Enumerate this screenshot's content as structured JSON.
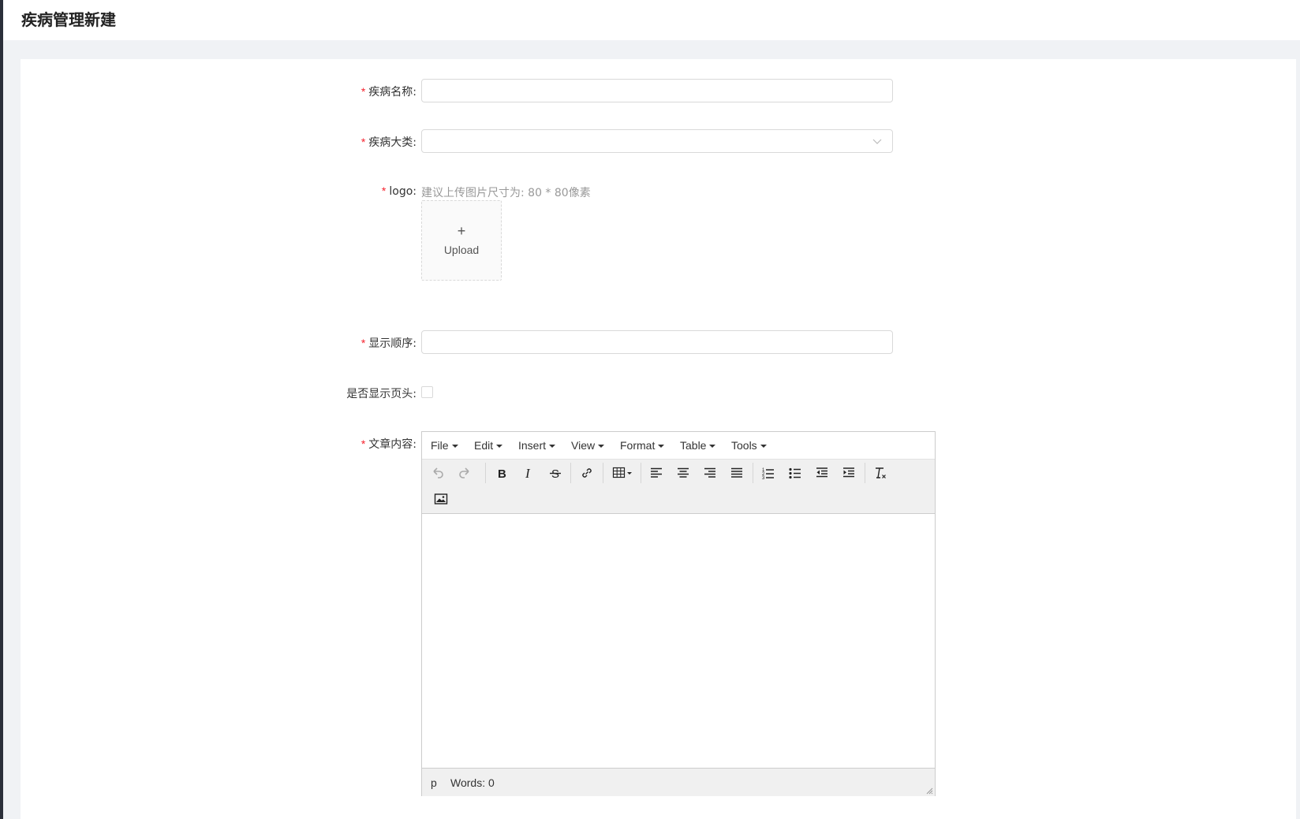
{
  "page": {
    "title": "疾病管理新建"
  },
  "form": {
    "disease_name": {
      "label": "疾病名称:",
      "value": "",
      "placeholder": ""
    },
    "category": {
      "label": "疾病大类:",
      "value": ""
    },
    "logo": {
      "label": "logo:",
      "hint": "建议上传图片尺寸为: 80 * 80像素",
      "upload_plus": "+",
      "upload_label": "Upload"
    },
    "display_order": {
      "label": "显示顺序:",
      "value": ""
    },
    "show_header": {
      "label": "是否显示页头:",
      "checked": false
    },
    "content": {
      "label": "文章内容:"
    },
    "required_mark": "*"
  },
  "editor": {
    "menus": [
      "File",
      "Edit",
      "Insert",
      "View",
      "Format",
      "Table",
      "Tools"
    ],
    "toolbar_icons": [
      "undo-icon",
      "redo-icon",
      "bold-icon",
      "italic-icon",
      "strikethrough-icon",
      "link-icon",
      "table-icon",
      "align-left-icon",
      "align-center-icon",
      "align-right-icon",
      "align-justify-icon",
      "numbered-list-icon",
      "bullet-list-icon",
      "outdent-icon",
      "indent-icon",
      "clear-format-icon",
      "image-icon"
    ],
    "status_path": "p",
    "word_count": "Words: 0"
  }
}
